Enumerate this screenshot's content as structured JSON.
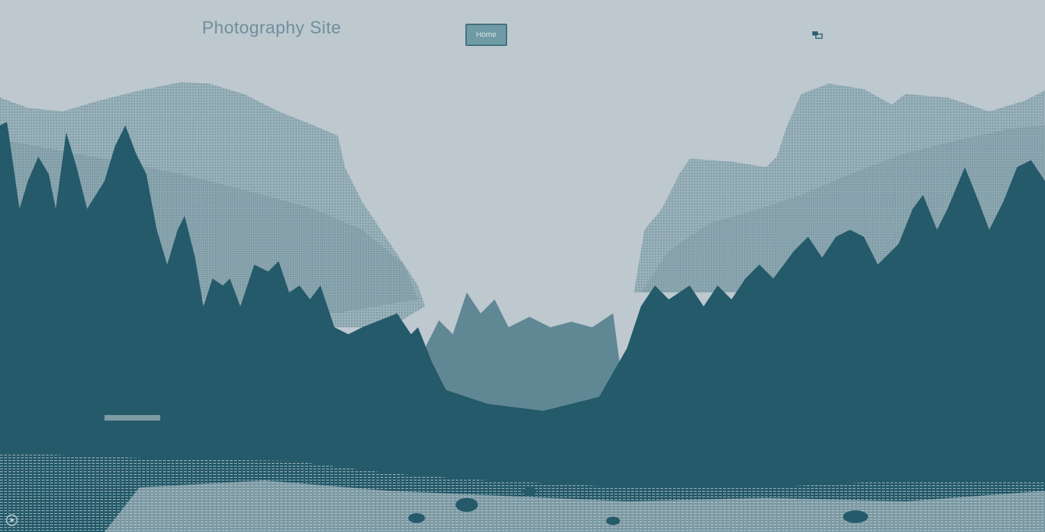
{
  "header": {
    "site_title": "Photography Site",
    "nav_home_label": "Home"
  },
  "icons": {
    "top_right": "window-icon",
    "bottom_left": "play-icon"
  },
  "colors": {
    "sky": "#bec8cf",
    "mountain": "#8fa9b3",
    "forest": "#245a69",
    "title": "#6e8f9c",
    "button": "#6f9aa6"
  }
}
